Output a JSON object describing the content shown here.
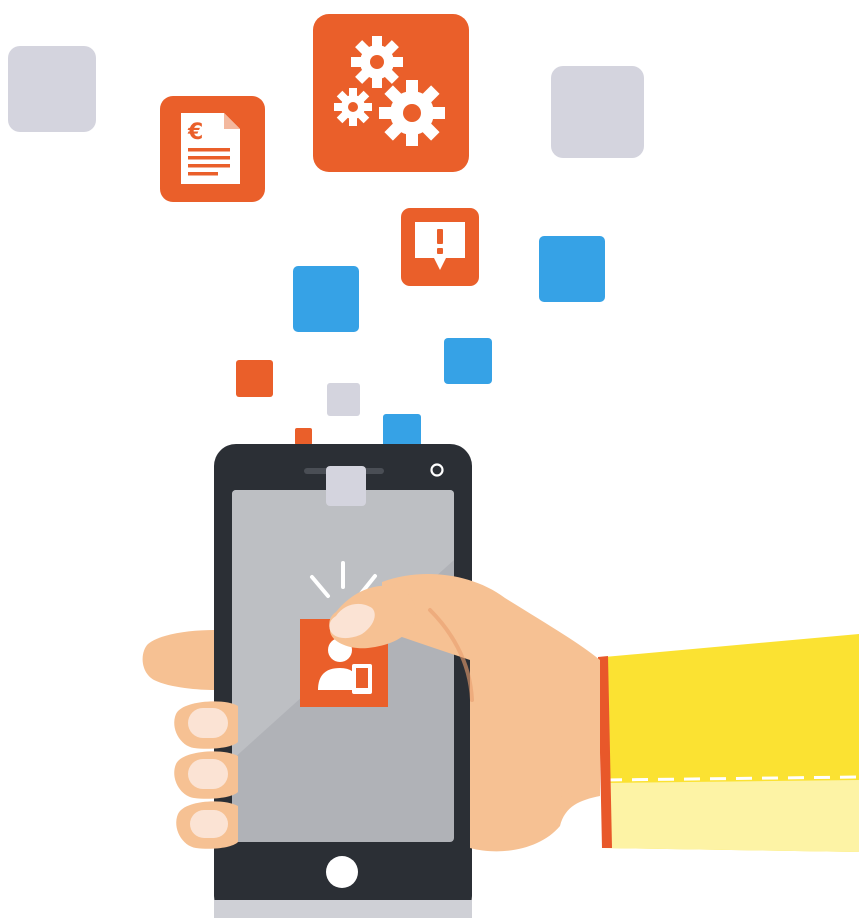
{
  "colors": {
    "orange": "#ea5f2a",
    "orange_dark": "#d94f1e",
    "blue": "#36a2e6",
    "grey_tile": "#d4d4de",
    "phone_body": "#2b2f35",
    "phone_screen": "#b0b2b7",
    "skin": "#f6c193",
    "skin_shadow": "#ea9f6e",
    "nail": "#fbe3d4",
    "sleeve": "#fbe232",
    "sleeve_light": "#fdf3a5",
    "sleeve_cuff": "#e8582a"
  },
  "icons": {
    "invoice": {
      "name": "euro-invoice-icon",
      "symbol": "€"
    },
    "settings": {
      "name": "gears-icon"
    },
    "alert": {
      "name": "alert-message-icon",
      "symbol": "!"
    },
    "app": {
      "name": "user-mobile-icon"
    }
  }
}
